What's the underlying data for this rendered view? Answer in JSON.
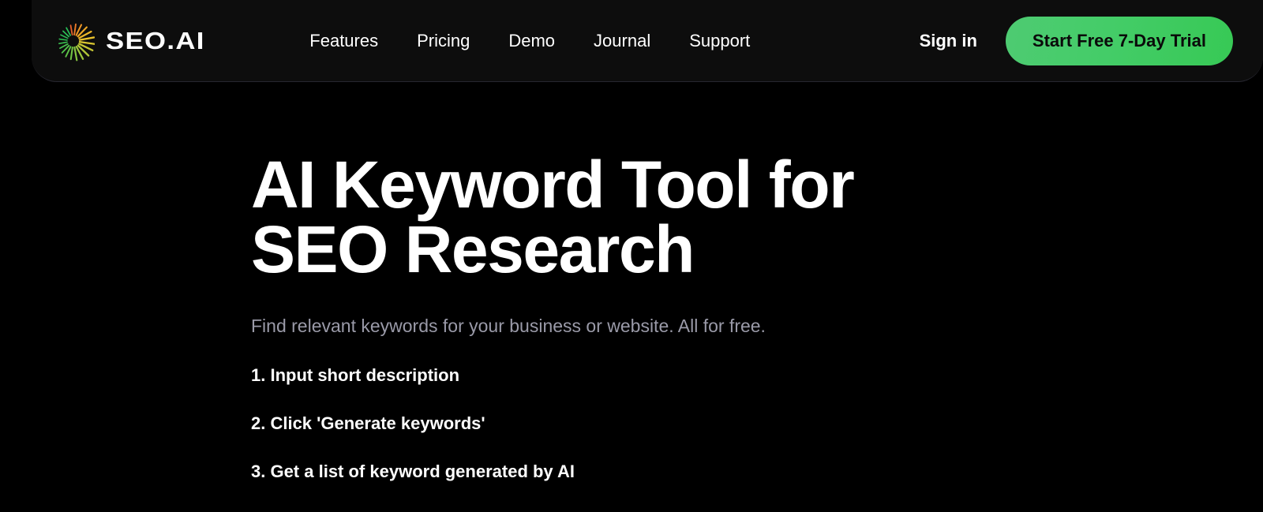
{
  "brand": {
    "logo_icon": "radial-burst-logo-icon",
    "wordmark": "SEO.AI",
    "logo_colors": [
      "#e8622a",
      "#f0a024",
      "#e8c42c",
      "#a8c63a",
      "#5cc247",
      "#2ebd52",
      "#27c45a"
    ]
  },
  "nav": {
    "items": [
      {
        "label": "Features"
      },
      {
        "label": "Pricing"
      },
      {
        "label": "Demo"
      },
      {
        "label": "Journal"
      },
      {
        "label": "Support"
      }
    ]
  },
  "header_actions": {
    "signin_label": "Sign in",
    "cta_label": "Start Free 7-Day Trial",
    "cta_color_start": "#4ecb72",
    "cta_color_end": "#37c955",
    "cta_text_color": "#0a0a0a"
  },
  "hero": {
    "title_line1": "AI Keyword Tool for SEO",
    "title_line2": "Research",
    "subtitle": "Find relevant keywords for your business or website. All for free.",
    "steps": [
      {
        "label": "1. Input short description"
      },
      {
        "label": "2. Click 'Generate keywords'"
      },
      {
        "label": "3. Get a list of keyword generated by AI"
      }
    ]
  },
  "theme": {
    "page_background": "#000000",
    "header_background": "#0d0d0d",
    "header_border": "#272730",
    "text_primary": "#ffffff",
    "text_muted": "#9a9aa8"
  }
}
